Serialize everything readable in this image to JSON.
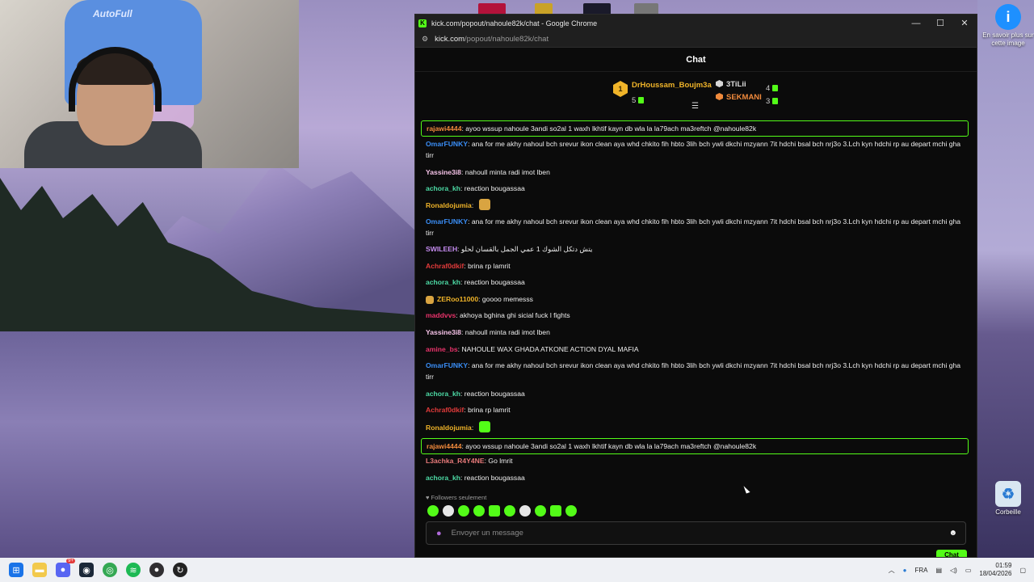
{
  "desktop": {
    "webcam": {
      "chair_text": "AutoFull"
    },
    "icons": {
      "learn_more": "En savoir plus sur cette image",
      "recycle_bin": "Corbeille"
    }
  },
  "browser": {
    "title": "kick.com/popout/nahoule82k/chat - Google Chrome",
    "url_host": "kick.com",
    "url_path": "/popout/nahoule82k/chat",
    "controls": {
      "minimize": "—",
      "maximize": "☐",
      "close": "✕"
    }
  },
  "chat": {
    "title": "Chat",
    "leaderboard": [
      {
        "rank": "1",
        "name": "DrHoussam_Boujm3a",
        "count": "5",
        "color": "#f0b429"
      },
      {
        "rank": "2",
        "name": "3TiLii",
        "count": "4",
        "color": "#d6d6d6"
      },
      {
        "rank": "3",
        "name": "SEKMANI",
        "count": "3",
        "color": "#f08a3c"
      }
    ],
    "messages": [
      {
        "user": "rajawi4444",
        "color": "#f08a3c",
        "text": "ayoo wssup nahoule 3andi so2al 1 waxh lkhtif kayn db wla la la79ach ma3reftch @nahoule82k",
        "highlight": true
      },
      {
        "user": "OmarFUNKY",
        "color": "#3a8ef6",
        "text": "ana for me akhy nahoul bch srevur ikon clean aya whd chkito fih hbto 3lih bch ywli dkchi mzyann 7it hdchi bsal bch nrj3o 3.Lch kyn hdchi rp au depart mchi gha tirr"
      },
      {
        "user": "Yassine3i8",
        "color": "#f5c2e7",
        "text": "nahoull minta radi imot lben"
      },
      {
        "user": "achora_kh",
        "color": "#4cd9a4",
        "text": "reaction bougassaa"
      },
      {
        "user": "Ronaldojumia",
        "color": "#f0b429",
        "text": "",
        "emote": "#d9a441"
      },
      {
        "user": "OmarFUNKY",
        "color": "#3a8ef6",
        "text": "ana for me akhy nahoul bch srevur ikon clean aya whd chkito fih hbto 3lih bch ywli dkchi mzyann 7it hdchi bsal bch nrj3o 3.Lch kyn hdchi rp au depart mchi gha tirr"
      },
      {
        "user": "SWILEEH",
        "color": "#c58cf0",
        "text": "يتش دتكل الشوك 1 عمي الجمل بالقسان لحلو"
      },
      {
        "user": "Achraf0dkif",
        "color": "#e23b3b",
        "text": "brina rp lamrit"
      },
      {
        "user": "achora_kh",
        "color": "#4cd9a4",
        "text": "reaction bougassaa"
      },
      {
        "user": "ZERoo11000",
        "color": "#f0b429",
        "text": "goooo memesss",
        "badge": true
      },
      {
        "user": "maddvvs",
        "color": "#e8336a",
        "text": "akhoya bghina ghi sicial fuck l fights"
      },
      {
        "user": "Yassine3i8",
        "color": "#f5c2e7",
        "text": "nahoull minta radi imot lben"
      },
      {
        "user": "amine_bs",
        "color": "#e8336a",
        "text": "NAHOULE WAX GHADA ATKONE ACTION DYAL MAFIA"
      },
      {
        "user": "OmarFUNKY",
        "color": "#3a8ef6",
        "text": "ana for me akhy nahoul bch srevur ikon clean aya whd chkito fih hbto 3lih bch ywli dkchi mzyann 7it hdchi bsal bch nrj3o 3.Lch kyn hdchi rp au depart mchi gha tirr"
      },
      {
        "user": "achora_kh",
        "color": "#4cd9a4",
        "text": "reaction bougassaa"
      },
      {
        "user": "Achraf0dkif",
        "color": "#e23b3b",
        "text": "brina rp lamrit"
      },
      {
        "user": "Ronaldojumia",
        "color": "#f0b429",
        "text": "",
        "emote": "#53fc18"
      },
      {
        "user": "rajawi4444",
        "color": "#f08a3c",
        "text": "ayoo wssup nahoule 3andi so2al 1 waxh lkhtif kayn db wla la la79ach ma3reftch @nahoule82k",
        "highlight": true
      },
      {
        "user": "L3achka_R4Y4NE",
        "color": "#e87a7a",
        "text": "Go lmrit"
      },
      {
        "user": "achora_kh",
        "color": "#4cd9a4",
        "text": "reaction bougassaa"
      }
    ],
    "followers_only": "Followers seulement",
    "input_placeholder": "Envoyer un message",
    "send_label": "Chat"
  },
  "taskbar": {
    "language": "FRA",
    "time": "01:59",
    "date": "18/04/2026",
    "discord_badge": "9+"
  }
}
